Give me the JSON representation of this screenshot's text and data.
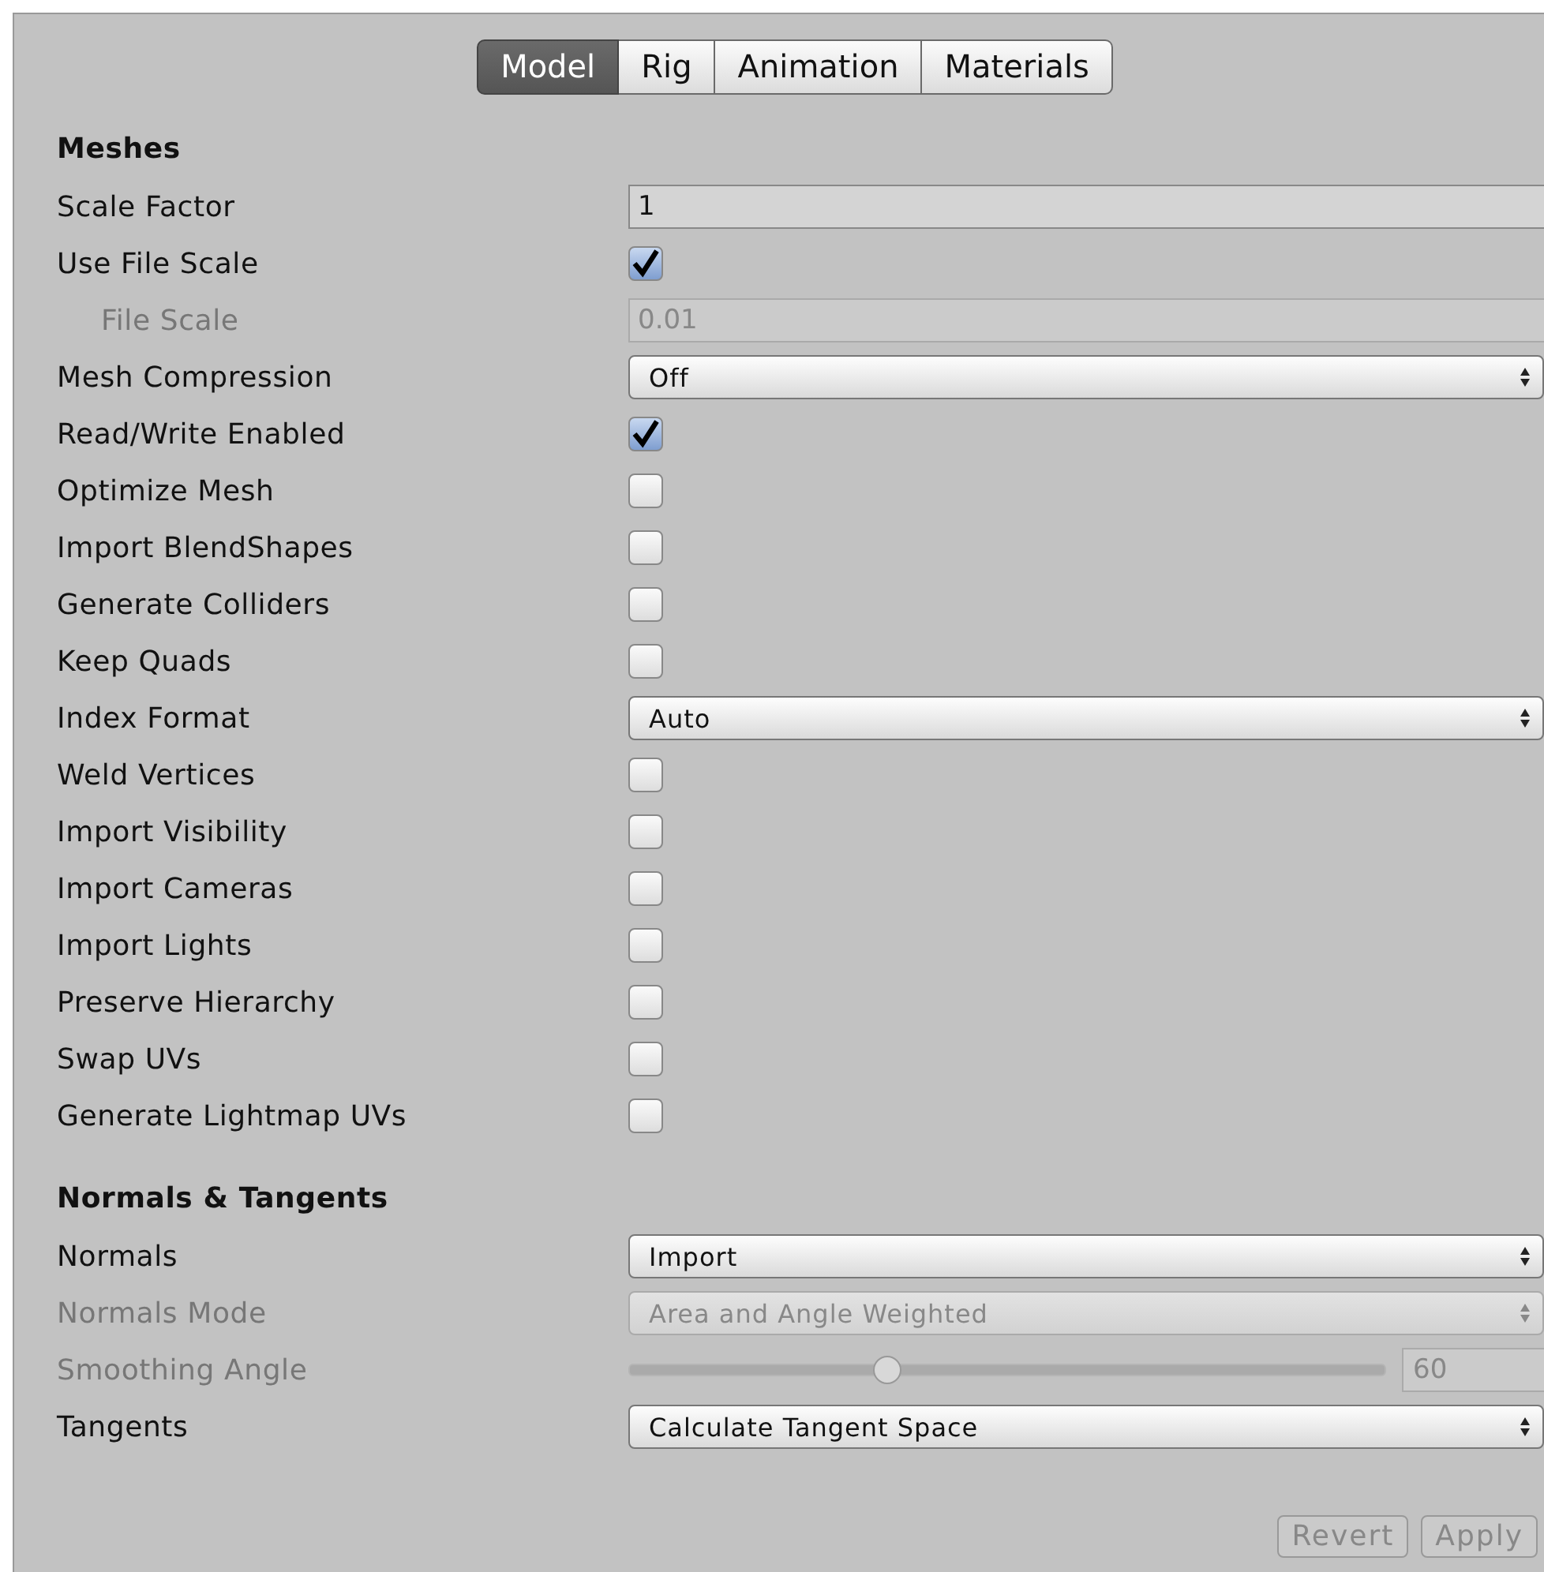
{
  "tabs": [
    {
      "label": "Model",
      "selected": true
    },
    {
      "label": "Rig",
      "selected": false
    },
    {
      "label": "Animation",
      "selected": false
    },
    {
      "label": "Materials",
      "selected": false
    }
  ],
  "sections": [
    {
      "title": "Meshes",
      "rows": [
        {
          "label": "Scale Factor",
          "kind": "text",
          "value": "1",
          "disabled": false
        },
        {
          "label": "Use File Scale",
          "kind": "checkbox",
          "checked": true,
          "disabled": false,
          "children": [
            {
              "label": "File Scale",
              "kind": "text",
              "value": "0.01",
              "disabled": true
            }
          ]
        },
        {
          "label": "Mesh Compression",
          "kind": "dropdown",
          "value": "Off",
          "disabled": false
        },
        {
          "label": "Read/Write Enabled",
          "kind": "checkbox",
          "checked": true,
          "disabled": false
        },
        {
          "label": "Optimize Mesh",
          "kind": "checkbox",
          "checked": false,
          "disabled": false
        },
        {
          "label": "Import BlendShapes",
          "kind": "checkbox",
          "checked": false,
          "disabled": false
        },
        {
          "label": "Generate Colliders",
          "kind": "checkbox",
          "checked": false,
          "disabled": false
        },
        {
          "label": "Keep Quads",
          "kind": "checkbox",
          "checked": false,
          "disabled": false
        },
        {
          "label": "Index Format",
          "kind": "dropdown",
          "value": "Auto",
          "disabled": false
        },
        {
          "label": "Weld Vertices",
          "kind": "checkbox",
          "checked": false,
          "disabled": false
        },
        {
          "label": "Import Visibility",
          "kind": "checkbox",
          "checked": false,
          "disabled": false
        },
        {
          "label": "Import Cameras",
          "kind": "checkbox",
          "checked": false,
          "disabled": false
        },
        {
          "label": "Import Lights",
          "kind": "checkbox",
          "checked": false,
          "disabled": false
        },
        {
          "label": "Preserve Hierarchy",
          "kind": "checkbox",
          "checked": false,
          "disabled": false
        },
        {
          "label": "Swap UVs",
          "kind": "checkbox",
          "checked": false,
          "disabled": false
        },
        {
          "label": "Generate Lightmap UVs",
          "kind": "checkbox",
          "checked": false,
          "disabled": false
        }
      ]
    },
    {
      "title": "Normals & Tangents",
      "rows": [
        {
          "label": "Normals",
          "kind": "dropdown",
          "value": "Import",
          "disabled": false
        },
        {
          "label": "Normals Mode",
          "kind": "dropdown",
          "value": "Area and Angle Weighted",
          "disabled": true
        },
        {
          "label": "Smoothing Angle",
          "kind": "slider",
          "level": 0.34,
          "value": "60",
          "disabled": true
        },
        {
          "label": "Tangents",
          "kind": "dropdown",
          "value": "Calculate Tangent Space",
          "disabled": false
        }
      ]
    }
  ],
  "buttons": [
    {
      "label": "Revert",
      "disabled": true
    },
    {
      "label": "Apply",
      "disabled": true
    }
  ]
}
